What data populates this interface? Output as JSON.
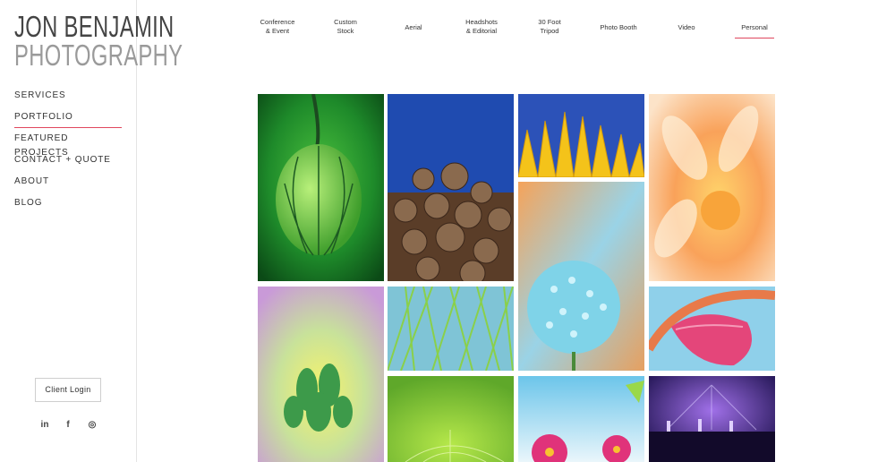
{
  "logo": {
    "line1": "JON BENJAMIN",
    "line2": "PHOTOGRAPHY"
  },
  "sidebar": {
    "items": [
      {
        "label": "SERVICES"
      },
      {
        "label": "PORTFOLIO",
        "active": true
      },
      {
        "label": "FEATURED PROJECTS"
      },
      {
        "label": "CONTACT + QUOTE"
      },
      {
        "label": "ABOUT"
      },
      {
        "label": "BLOG"
      }
    ],
    "client_login": "Client Login",
    "social": [
      {
        "icon": "linkedin-icon",
        "glyph": "in"
      },
      {
        "icon": "facebook-icon",
        "glyph": "f"
      },
      {
        "icon": "instagram-icon",
        "glyph": "◎"
      }
    ]
  },
  "tabs": [
    {
      "line1": "Conference",
      "line2": "& Event"
    },
    {
      "line1": "Custom",
      "line2": "Stock"
    },
    {
      "line1": "Aerial",
      "line2": ""
    },
    {
      "line1": "Headshots",
      "line2": "& Editorial"
    },
    {
      "line1": "30 Foot",
      "line2": "Tripod"
    },
    {
      "line1": "Photo Booth",
      "line2": ""
    },
    {
      "line1": "Video",
      "line2": ""
    },
    {
      "line1": "Personal",
      "line2": "",
      "active": true
    }
  ],
  "colors": {
    "accent": "#e0475e",
    "border": "#e4e4e4"
  }
}
